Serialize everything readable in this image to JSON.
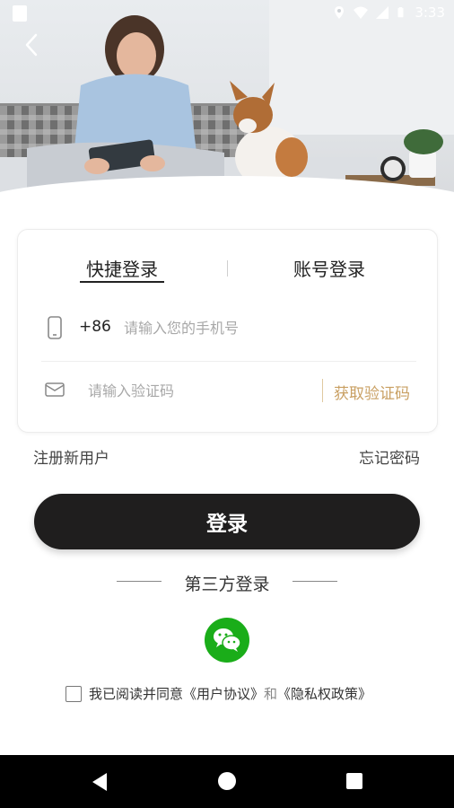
{
  "status_bar": {
    "time": "3:33",
    "icons": [
      "sim-card-icon",
      "location-icon",
      "wifi-icon",
      "signal-icon",
      "battery-icon"
    ]
  },
  "header": {
    "back_icon": "chevron-left-icon",
    "hero_image": "woman-with-dog-on-sofa"
  },
  "login_card": {
    "tabs": [
      {
        "label": "快捷登录",
        "active": true
      },
      {
        "label": "账号登录",
        "active": false
      }
    ],
    "phone": {
      "icon": "phone-icon",
      "country_code": "+86",
      "value": "",
      "placeholder": "请输入您的手机号"
    },
    "code": {
      "icon": "mail-icon",
      "value": "",
      "placeholder": "请输入验证码",
      "get_code_label": "获取验证码"
    }
  },
  "links": {
    "register": "注册新用户",
    "forgot": "忘记密码"
  },
  "login_button": "登录",
  "third_party": {
    "title": "第三方登录",
    "providers": [
      {
        "icon": "wechat-icon",
        "name": "WeChat"
      }
    ]
  },
  "agreement": {
    "prefix": "我已阅读并同意",
    "user_agreement": "《用户协议》",
    "and": "和",
    "privacy_policy": "《隐私权政策》",
    "checked": false
  },
  "colors": {
    "accent_gold": "#c9a063",
    "button_dark": "#1f1e1e",
    "wechat_green": "#1aad19"
  },
  "nav_bar": [
    "back-triangle-icon",
    "home-circle-icon",
    "recents-square-icon"
  ]
}
